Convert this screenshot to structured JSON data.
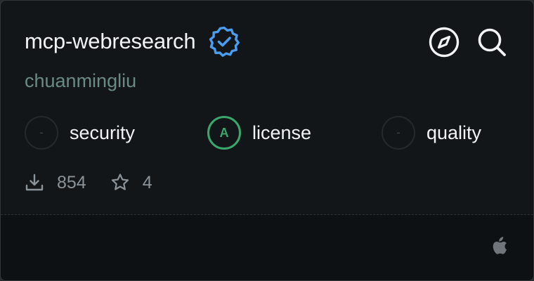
{
  "server": {
    "name": "mcp-webresearch",
    "owner": "chuanmingliu",
    "verified": true
  },
  "actions": {
    "explore_icon": "compass-icon",
    "search_icon": "search-icon"
  },
  "metrics": [
    {
      "label": "security",
      "grade": "-"
    },
    {
      "label": "license",
      "grade": "A"
    },
    {
      "label": "quality",
      "grade": "-"
    }
  ],
  "stats": {
    "downloads": "854",
    "stars": "4"
  },
  "footer": {
    "platform_icon": "apple-icon"
  },
  "colors": {
    "background": "#121619",
    "verified_badge": "#4a9df0",
    "grade_pass": "#3aa76d",
    "owner_text": "#6c8a85"
  }
}
